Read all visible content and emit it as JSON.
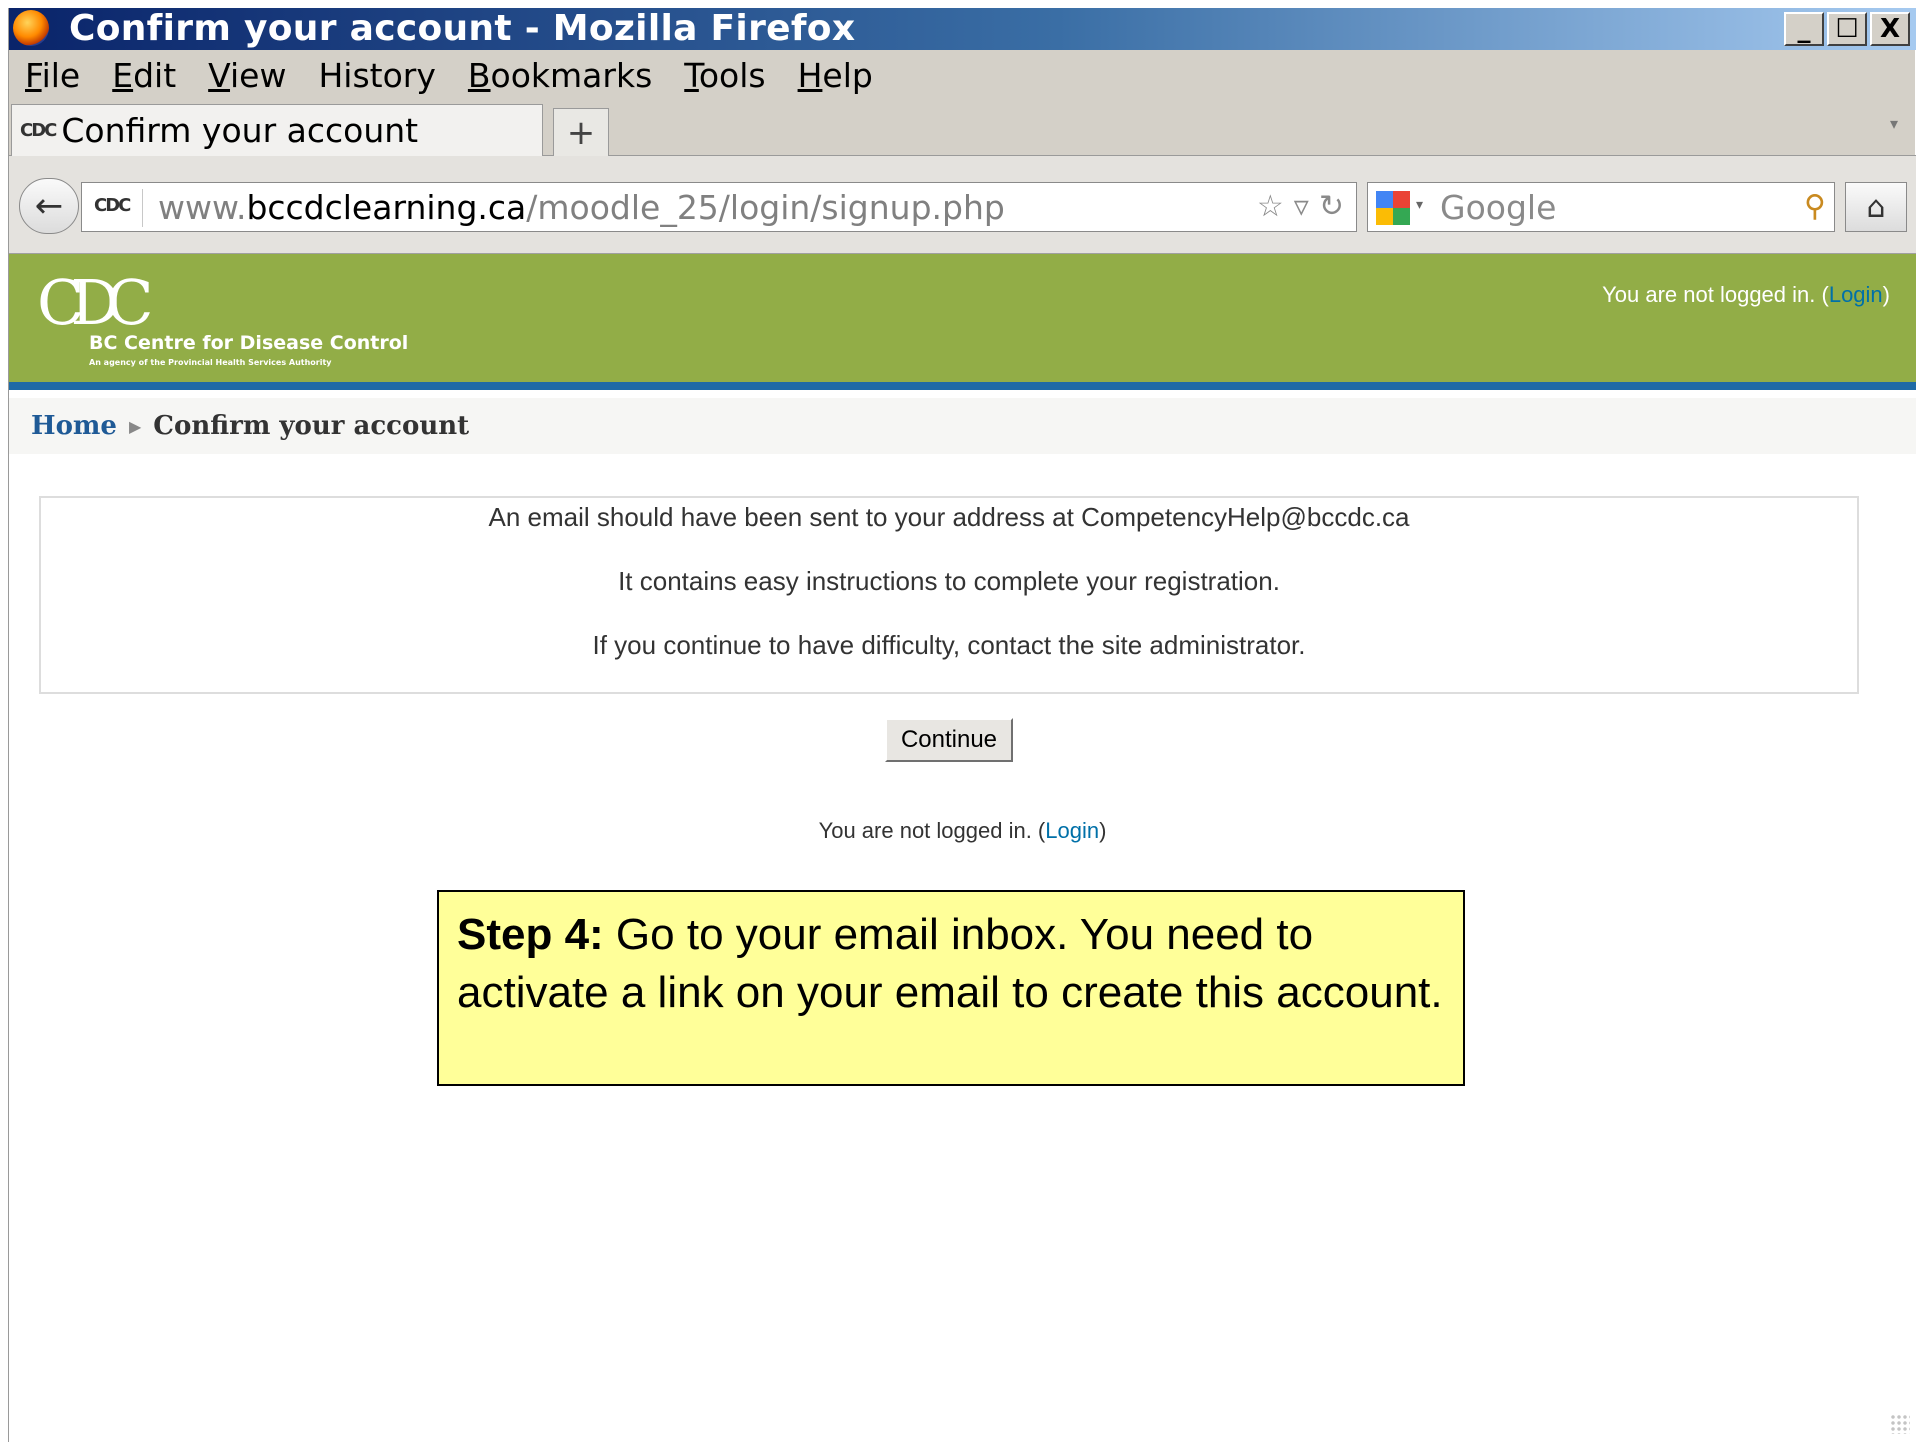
{
  "window": {
    "title": "Confirm your account - Mozilla Firefox",
    "controls": {
      "minimize": "_",
      "maximize": "☐",
      "close": "X"
    }
  },
  "menu": [
    {
      "first": "F",
      "rest": "ile"
    },
    {
      "first": "E",
      "rest": "dit"
    },
    {
      "first": "V",
      "rest": "iew"
    },
    {
      "first": "",
      "rest": "History",
      "label": "History"
    },
    {
      "first": "B",
      "rest": "ookmarks"
    },
    {
      "first": "T",
      "rest": "ools"
    },
    {
      "first": "H",
      "rest": "elp"
    }
  ],
  "tab": {
    "favicon": "CDC",
    "label": "Confirm your account",
    "new_tab": "+"
  },
  "address": {
    "favicon": "CDC",
    "prefix": "www.",
    "domain": "bccdclearning.ca",
    "path": "/moodle_25/login/signup.php"
  },
  "search": {
    "placeholder": "Google"
  },
  "header": {
    "logo_mark": "CDC",
    "logo_name": "BC Centre for Disease Control",
    "logo_sub": "An agency of the Provincial Health Services Authority",
    "login_text": "You are not logged in. (",
    "login_link": "Login",
    "login_close": ")"
  },
  "breadcrumb": {
    "home": "Home",
    "separator": "▶",
    "current": "Confirm your account"
  },
  "notice": {
    "line1": "An email should have been sent to your address at CompetencyHelp@bccdc.ca",
    "line2": "It contains easy instructions to complete your registration.",
    "line3": "If you continue to have difficulty, contact the site administrator."
  },
  "continue_label": "Continue",
  "footer": {
    "login_text": "You are not logged in. (",
    "login_link": "Login",
    "login_close": ")"
  },
  "callout": {
    "step": "Step 4:",
    "text": " Go to your email inbox. You need to activate a link on your email to create this account."
  },
  "colors": {
    "header_green": "#92ad47",
    "header_rule": "#1f6aa5",
    "callout_bg": "#ffff99",
    "link": "#0070a8"
  },
  "icons": {
    "window": "firefox-icon",
    "back": "back-arrow-icon",
    "bookmark": "star-icon",
    "dropdown": "dropdown-arrow-icon",
    "reload": "reload-icon",
    "search_engine": "google-icon",
    "search": "search-icon",
    "home": "home-icon"
  }
}
